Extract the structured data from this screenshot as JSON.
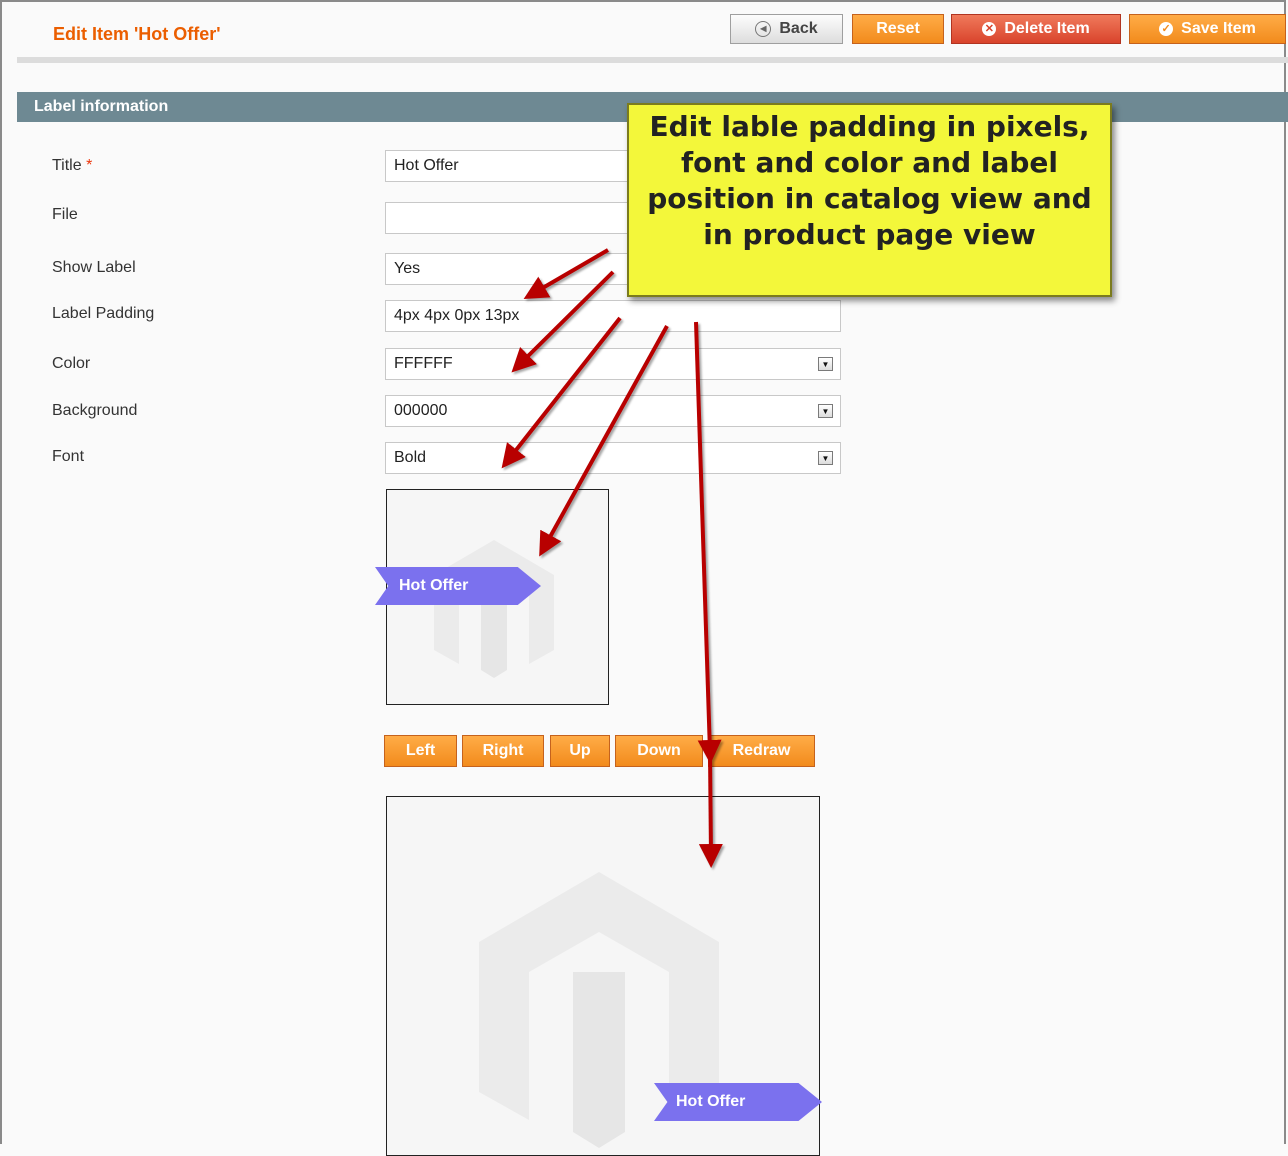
{
  "header": {
    "title": "Edit Item 'Hot Offer'",
    "buttons": {
      "back": "Back",
      "reset": "Reset",
      "delete": "Delete Item",
      "save": "Save Item"
    }
  },
  "section": {
    "title": "Label information"
  },
  "form": {
    "title": {
      "label": "Title",
      "required_mark": "*",
      "value": "Hot Offer"
    },
    "file": {
      "label": "File",
      "value": ""
    },
    "show_label": {
      "label": "Show Label",
      "value": "Yes"
    },
    "label_padding": {
      "label": "Label Padding",
      "value": "4px 4px 0px 13px"
    },
    "color": {
      "label": "Color",
      "value": "FFFFFF"
    },
    "background": {
      "label": "Background",
      "value": "000000"
    },
    "font": {
      "label": "Font",
      "value": "Bold"
    }
  },
  "preview": {
    "catalog_label": "Hot Offer",
    "product_label": "Hot Offer",
    "label_color": "#7b71ee"
  },
  "position_buttons": {
    "left": "Left",
    "right": "Right",
    "up": "Up",
    "down": "Down",
    "redraw": "Redraw"
  },
  "callout": {
    "text": "Edit lable padding in pixels, font and color and label position in catalog view and in product page view"
  },
  "colors": {
    "accent": "#eb5e00",
    "button": "#f28b1c",
    "section_header": "#6e8993",
    "callout_bg": "#f3f73a",
    "arrow": "#b80000"
  }
}
